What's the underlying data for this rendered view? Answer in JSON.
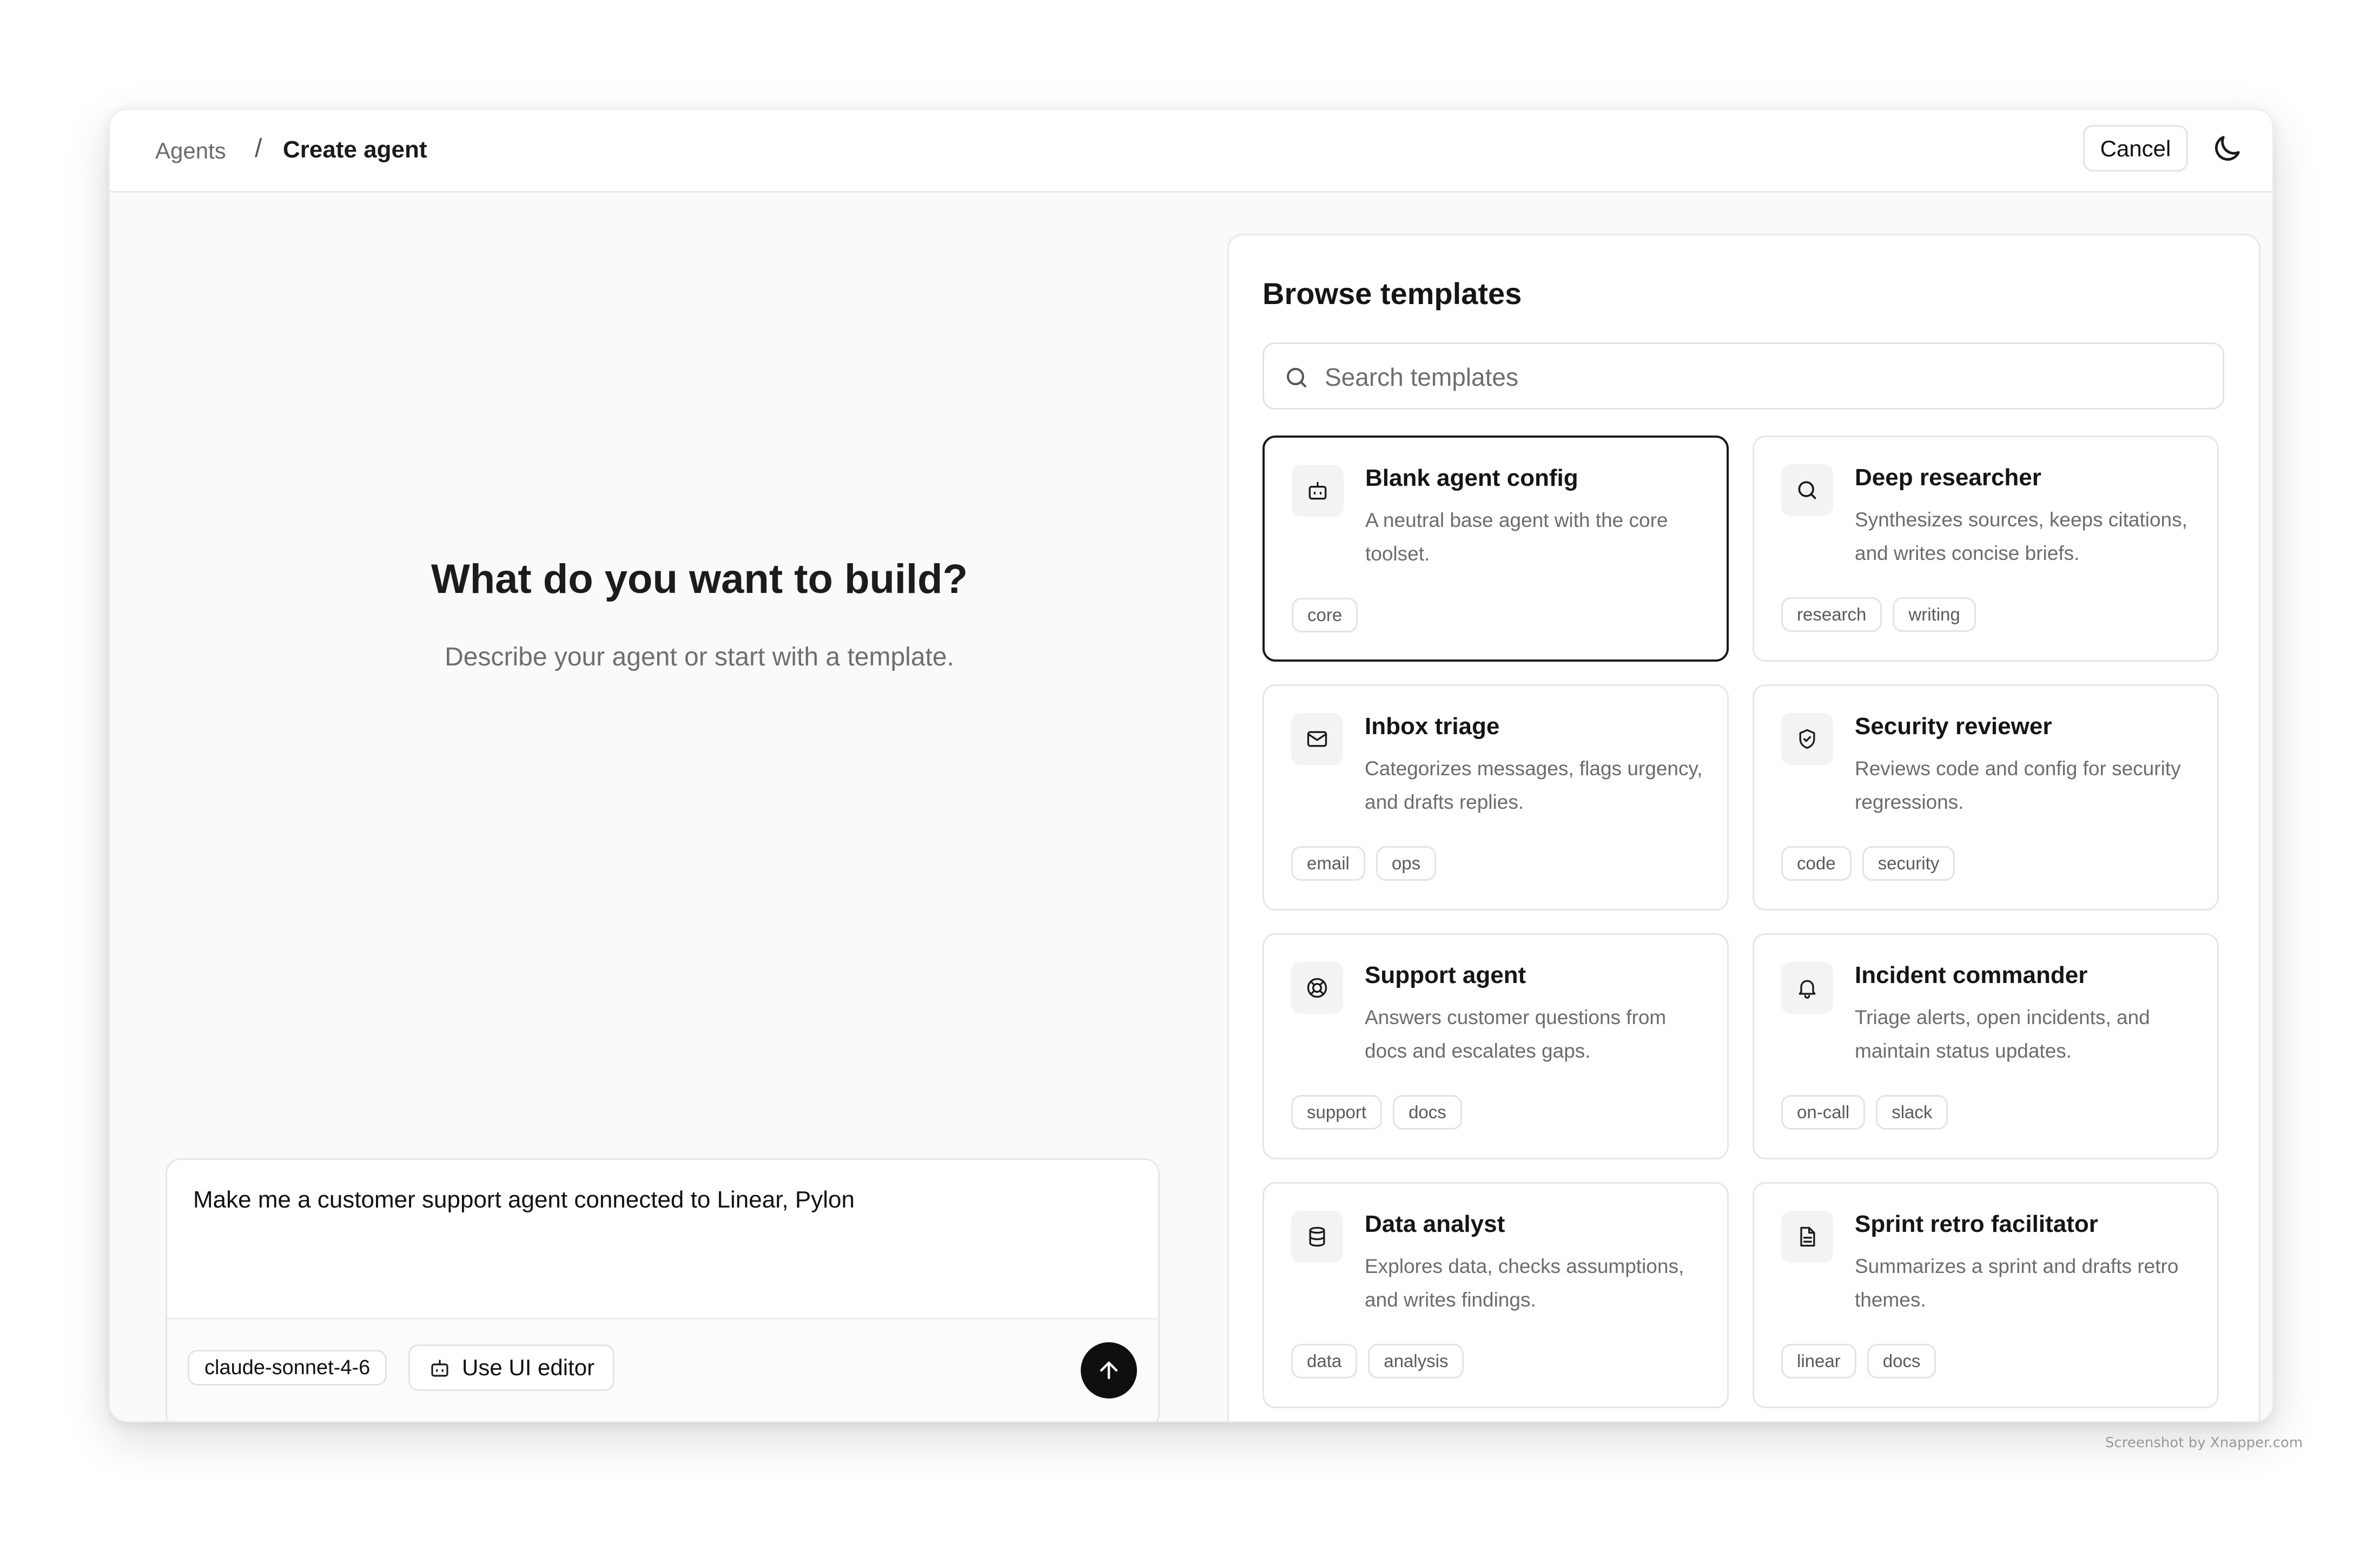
{
  "breadcrumb": {
    "parent": "Agents",
    "separator": "/",
    "current": "Create agent"
  },
  "header": {
    "cancel_label": "Cancel",
    "theme_icon": "moon-icon"
  },
  "hero": {
    "title": "What do you want to build?",
    "subtitle": "Describe your agent or start with a template."
  },
  "composer": {
    "text": "Make me a customer support agent connected to Linear, Pylon",
    "model": "claude-sonnet-4-6",
    "ui_editor_label": "Use UI editor",
    "send_icon": "arrow-up-icon"
  },
  "templates": {
    "title": "Browse templates",
    "search_placeholder": "Search templates",
    "items": [
      {
        "title": "Blank agent config",
        "description": "A neutral base agent with the core toolset.",
        "tags": [
          "core"
        ],
        "icon": "robot-icon",
        "selected": true
      },
      {
        "title": "Deep researcher",
        "description": "Synthesizes sources, keeps citations, and writes concise briefs.",
        "tags": [
          "research",
          "writing"
        ],
        "icon": "search-icon",
        "selected": false
      },
      {
        "title": "Inbox triage",
        "description": "Categorizes messages, flags urgency, and drafts replies.",
        "tags": [
          "email",
          "ops"
        ],
        "icon": "mail-icon",
        "selected": false
      },
      {
        "title": "Security reviewer",
        "description": "Reviews code and config for security regressions.",
        "tags": [
          "code",
          "security"
        ],
        "icon": "shield-icon",
        "selected": false
      },
      {
        "title": "Support agent",
        "description": "Answers customer questions from docs and escalates gaps.",
        "tags": [
          "support",
          "docs"
        ],
        "icon": "lifebuoy-icon",
        "selected": false
      },
      {
        "title": "Incident commander",
        "description": "Triage alerts, open incidents, and maintain status updates.",
        "tags": [
          "on-call",
          "slack"
        ],
        "icon": "bell-icon",
        "selected": false
      },
      {
        "title": "Data analyst",
        "description": "Explores data, checks assumptions, and writes findings.",
        "tags": [
          "data",
          "analysis"
        ],
        "icon": "database-icon",
        "selected": false
      },
      {
        "title": "Sprint retro facilitator",
        "description": "Summarizes a sprint and drafts retro themes.",
        "tags": [
          "linear",
          "docs"
        ],
        "icon": "document-icon",
        "selected": false
      }
    ]
  },
  "watermark": "Screenshot by Xnapper.com"
}
